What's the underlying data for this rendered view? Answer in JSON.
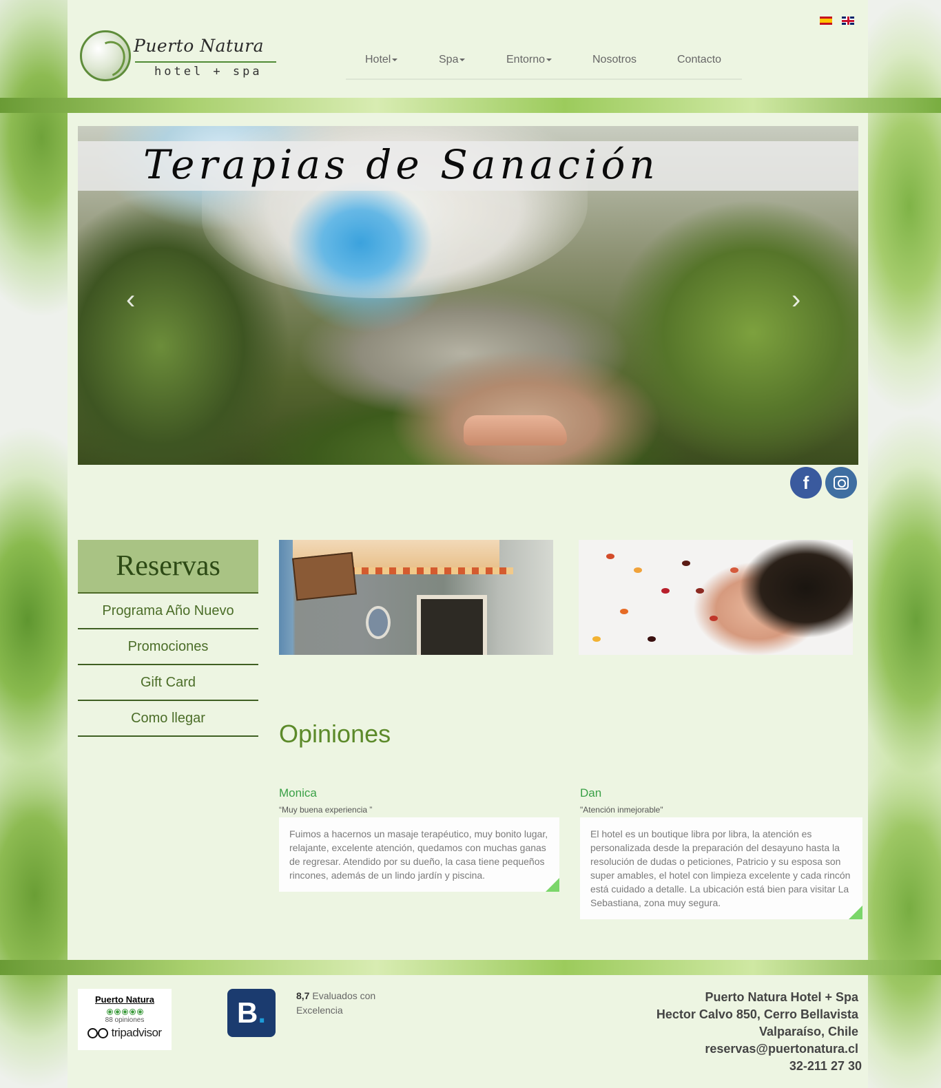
{
  "brand": {
    "name": "Puerto Natura",
    "sub": "hotel + spa"
  },
  "languages": [
    {
      "code": "es",
      "icon": "spain-flag-icon"
    },
    {
      "code": "en",
      "icon": "uk-flag-icon"
    }
  ],
  "nav": [
    {
      "label": "Hotel",
      "dropdown": true
    },
    {
      "label": "Spa",
      "dropdown": true
    },
    {
      "label": "Entorno",
      "dropdown": true
    },
    {
      "label": "Nosotros",
      "dropdown": false
    },
    {
      "label": "Contacto",
      "dropdown": false
    }
  ],
  "slider": {
    "title": "Terapias de Sanación",
    "prev": "‹",
    "next": "›"
  },
  "social": {
    "facebook": "f"
  },
  "sidebar": {
    "title": "Reservas",
    "items": [
      "Programa Año Nuevo",
      "Promociones",
      "Gift Card",
      "Como llegar"
    ]
  },
  "opinions": {
    "title": "Opiniones",
    "items": [
      {
        "name": "Monica",
        "quote": "“Muy buena experiencia ”",
        "text": "Fuimos a hacernos un masaje terapéutico, muy bonito lugar, relajante, excelente atención, quedamos con muchas ganas de regresar. Atendido por su dueño, la casa tiene pequeños rincones, además de un lindo jardín y piscina."
      },
      {
        "name": "Dan",
        "quote": "\"Atención inmejorable\"",
        "text": "El hotel es un boutique libra por libra, la atención es personalizada desde la preparación del desayuno hasta la resolución de dudas o peticiones, Patricio y su esposa son super amables, el hotel con limpieza excelente y cada rincón está cuidado a detalle. La ubicación está bien para visitar La Sebastiana, zona muy segura."
      }
    ]
  },
  "footer": {
    "tripadvisor": {
      "name": "Puerto Natura",
      "reviews": "88 opiniones",
      "logo": "tripadvisor"
    },
    "booking": {
      "letter": "B",
      "dot": ".",
      "score": "8,7",
      "text": "Evaluados con Excelencia"
    },
    "address": [
      "Puerto Natura Hotel + Spa",
      "Hector Calvo 850, Cerro Bellavista",
      "Valparaíso, Chile",
      "reservas@puertonatura.cl",
      "32-211 27 30"
    ]
  },
  "colors": {
    "panel": "#edf5e2",
    "accent_green": "#5c8a2a",
    "reservas_bg": "#a9c384",
    "reviewer_name": "#39a046",
    "booking_blue": "#1b3b6f"
  }
}
